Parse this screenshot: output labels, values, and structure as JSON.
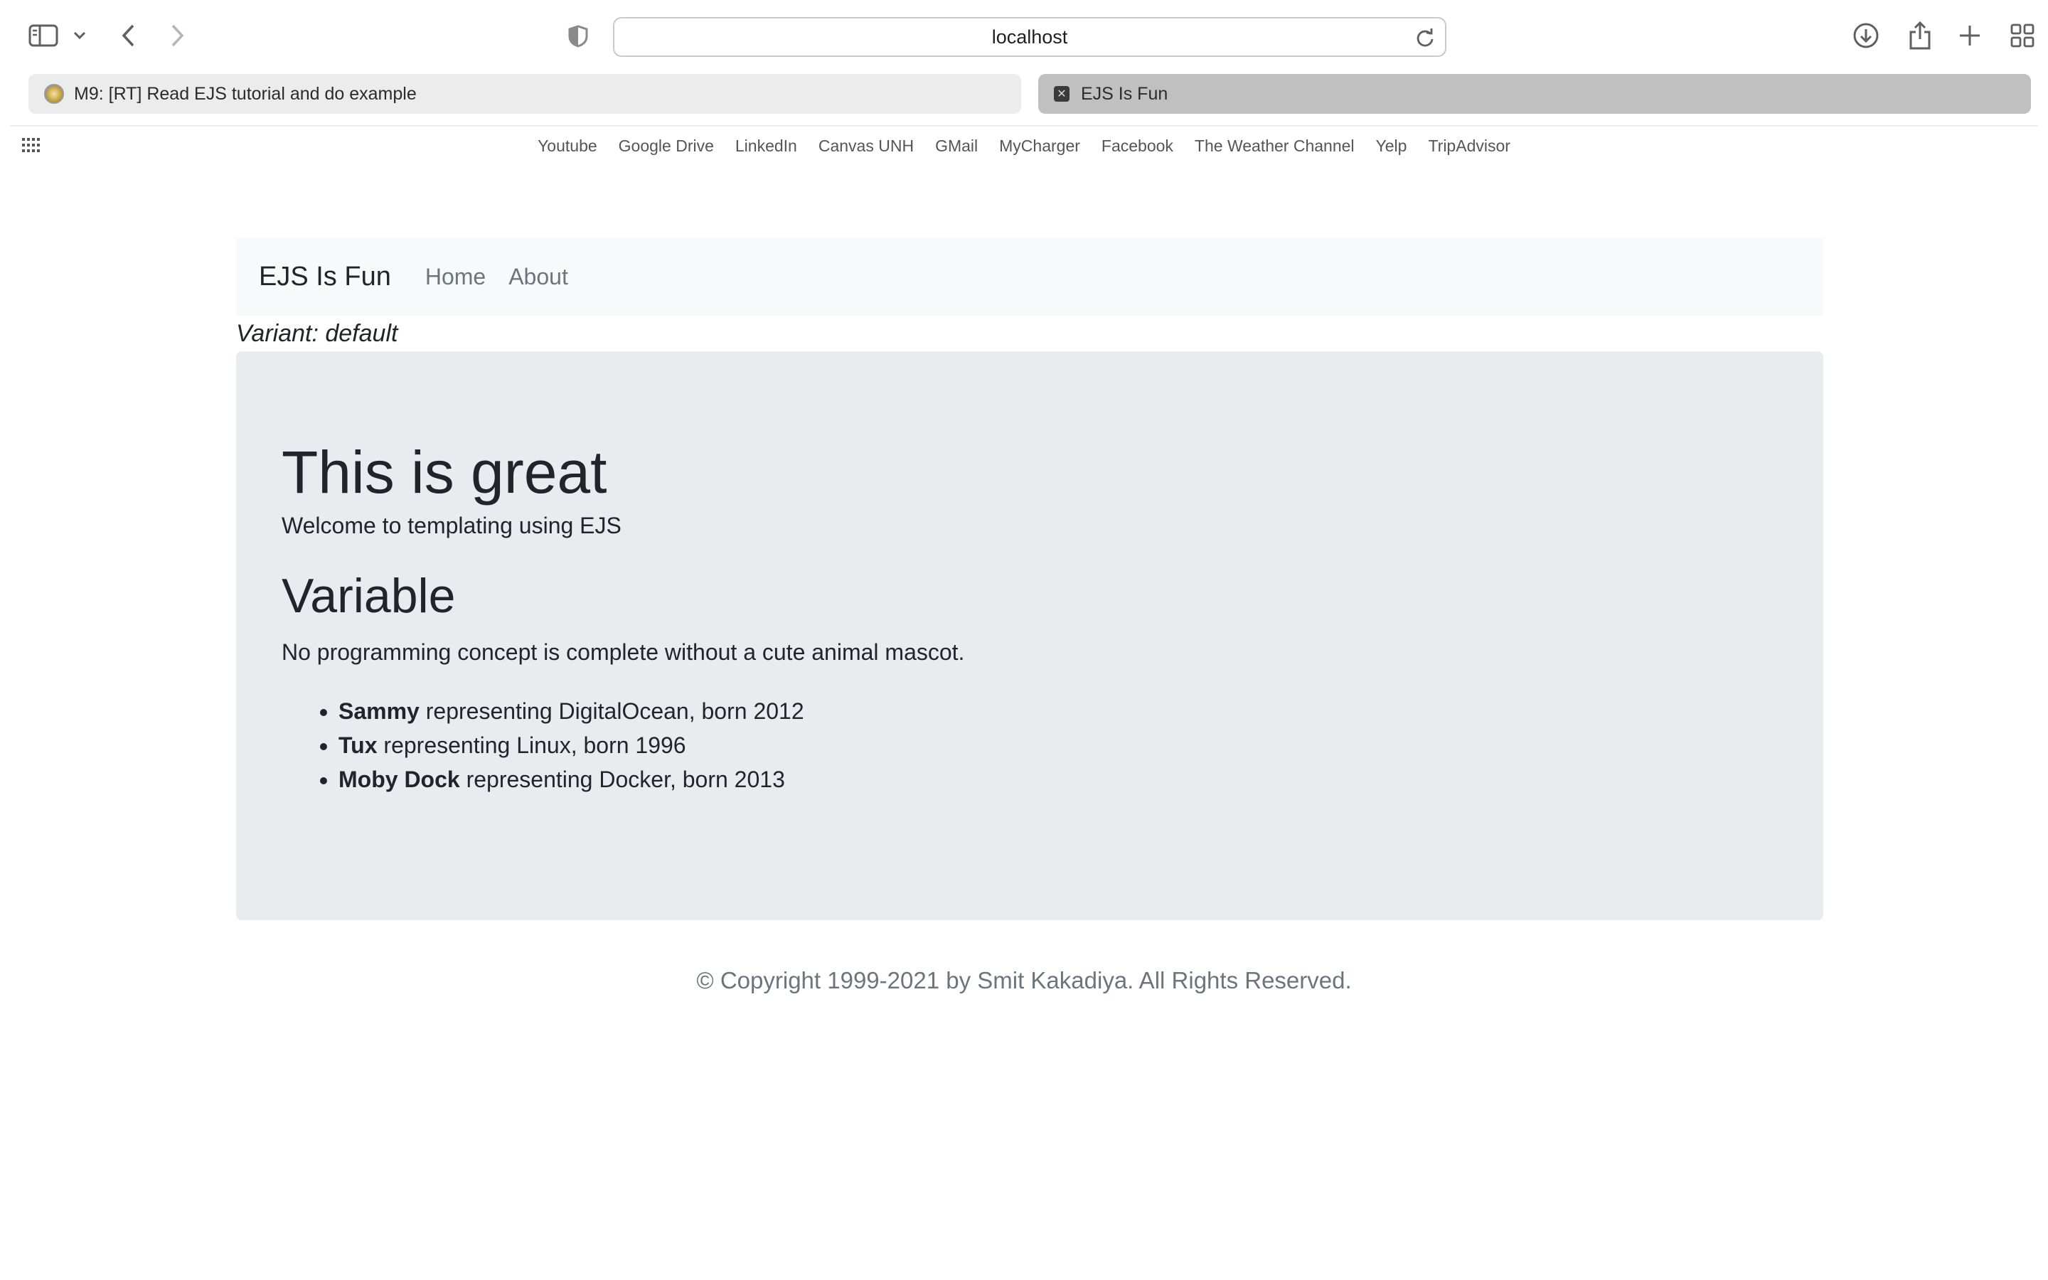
{
  "browser": {
    "address": "localhost",
    "tabs": [
      {
        "title": "M9: [RT] Read EJS tutorial and do example",
        "active": false
      },
      {
        "title": "EJS Is Fun",
        "active": true
      }
    ],
    "favorites": [
      "Youtube",
      "Google Drive",
      "LinkedIn",
      "Canvas UNH",
      "GMail",
      "MyCharger",
      "Facebook",
      "The Weather Channel",
      "Yelp",
      "TripAdvisor"
    ],
    "icons": {
      "sidebar": "sidebar-icon",
      "back": "chevron-left-icon",
      "forward": "chevron-right-icon",
      "privacy": "shield-icon",
      "reload": "reload-icon",
      "download": "download-icon",
      "share": "share-icon",
      "new_tab": "plus-icon",
      "tab_overview": "grid-icon"
    }
  },
  "navbar": {
    "brand": "EJS Is Fun",
    "links": [
      "Home",
      "About"
    ]
  },
  "variant": "Variant: default",
  "jumbotron": {
    "title": "This is great",
    "lead": "Welcome to templating using EJS",
    "subtitle": "Variable",
    "text": "No programming concept is complete without a cute animal mascot.",
    "mascots": [
      {
        "name": "Sammy",
        "rest": " representing DigitalOcean, born 2012"
      },
      {
        "name": "Tux",
        "rest": " representing Linux, born 1996"
      },
      {
        "name": "Moby Dock",
        "rest": " representing Docker, born 2013"
      }
    ]
  },
  "footer": "© Copyright 1999-2021 by Smit Kakadiya. All Rights Reserved.",
  "colors": {
    "navbar_bg": "#f8f9fa",
    "jumbotron_bg": "#e9ecef",
    "muted_text": "#6c757d",
    "body_text": "#212529"
  }
}
